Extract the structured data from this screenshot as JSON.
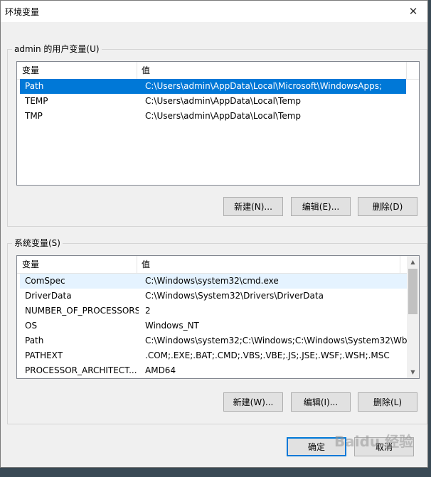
{
  "window": {
    "title": "环境变量",
    "close_glyph": "✕"
  },
  "user_vars": {
    "group_label": "admin 的用户变量(U)",
    "col_name": "变量",
    "col_value": "值",
    "rows": [
      {
        "name": "Path",
        "value": "C:\\Users\\admin\\AppData\\Local\\Microsoft\\WindowsApps;"
      },
      {
        "name": "TEMP",
        "value": "C:\\Users\\admin\\AppData\\Local\\Temp"
      },
      {
        "name": "TMP",
        "value": "C:\\Users\\admin\\AppData\\Local\\Temp"
      }
    ],
    "new_label": "新建(N)...",
    "edit_label": "编辑(E)...",
    "delete_label": "删除(D)"
  },
  "system_vars": {
    "group_label": "系统变量(S)",
    "col_name": "变量",
    "col_value": "值",
    "rows": [
      {
        "name": "ComSpec",
        "value": "C:\\Windows\\system32\\cmd.exe"
      },
      {
        "name": "DriverData",
        "value": "C:\\Windows\\System32\\Drivers\\DriverData"
      },
      {
        "name": "NUMBER_OF_PROCESSORS",
        "value": "2"
      },
      {
        "name": "OS",
        "value": "Windows_NT"
      },
      {
        "name": "Path",
        "value": "C:\\Windows\\system32;C:\\Windows;C:\\Windows\\System32\\Wb..."
      },
      {
        "name": "PATHEXT",
        "value": ".COM;.EXE;.BAT;.CMD;.VBS;.VBE;.JS;.JSE;.WSF;.WSH;.MSC"
      },
      {
        "name": "PROCESSOR_ARCHITECT...",
        "value": "AMD64"
      }
    ],
    "new_label": "新建(W)...",
    "edit_label": "编辑(I)...",
    "delete_label": "删除(L)"
  },
  "footer": {
    "ok_label": "确定",
    "cancel_label": "取消"
  },
  "watermark": "Baidu 经验",
  "colors": {
    "selection": "#0078d7",
    "hover": "#e5f3ff"
  }
}
